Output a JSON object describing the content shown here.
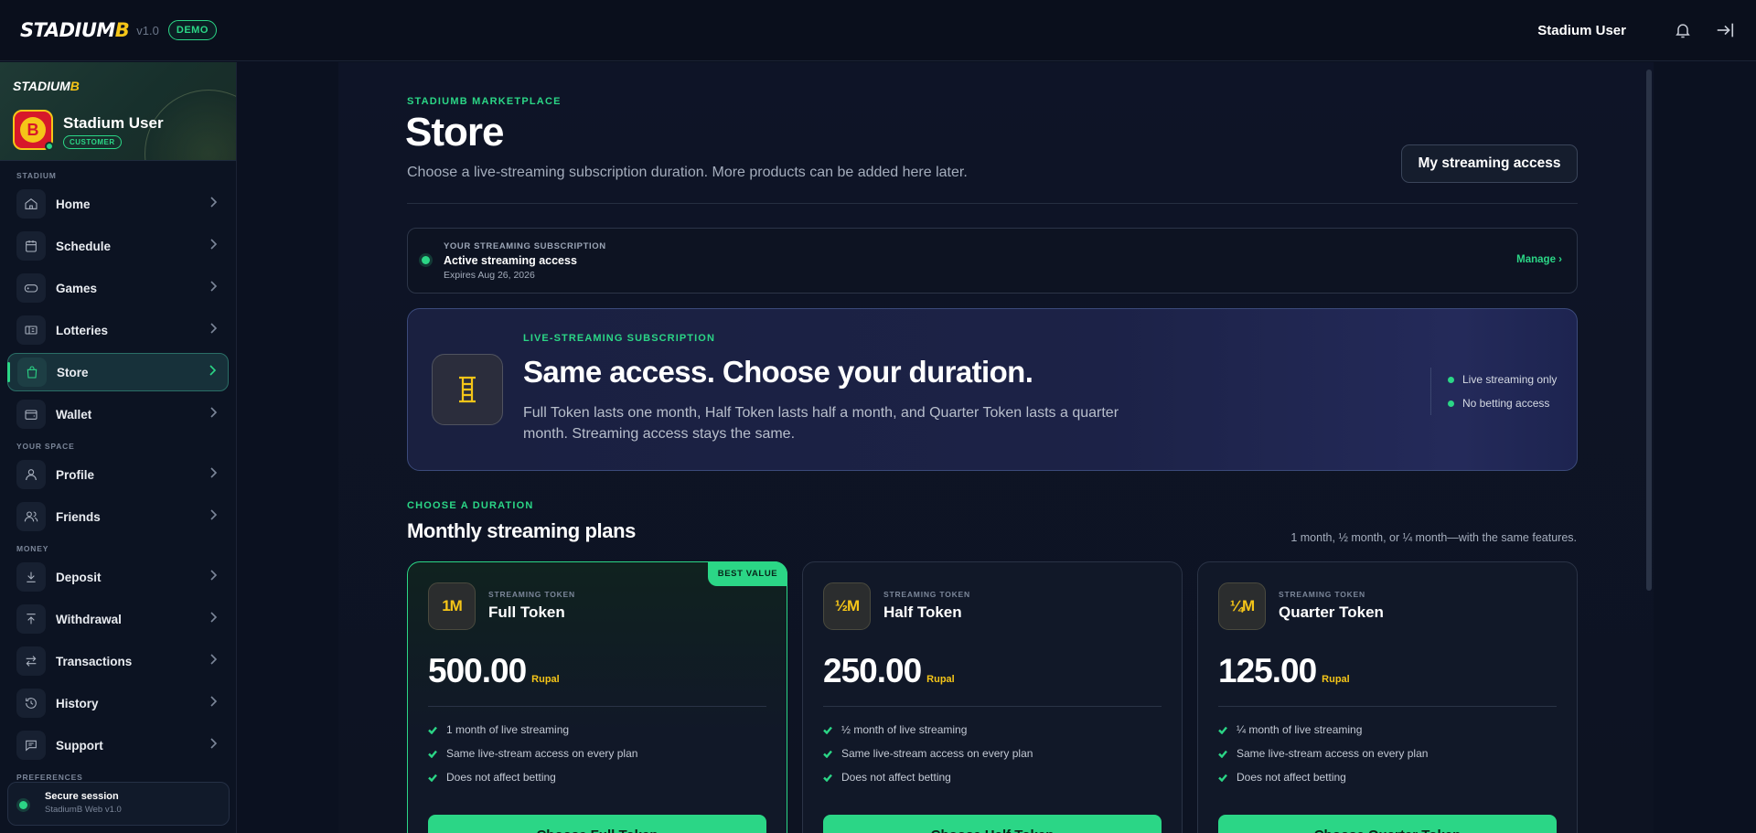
{
  "topbar": {
    "logo_main": "STADIUM",
    "logo_accent": "B",
    "version": "v1.0",
    "badge": "DEMO",
    "user": "Stadium User",
    "icons": [
      "bell-icon",
      "logout-icon"
    ]
  },
  "sidebar": {
    "mini_logo_main": "STADIUM",
    "mini_logo_accent": "B",
    "profile": {
      "avatar_letter": "B",
      "name": "Stadium User",
      "role": "CUSTOMER"
    },
    "sections": {
      "stadium": "STADIUM",
      "your_space": "YOUR SPACE",
      "money": "MONEY",
      "preferences": "PREFERENCES"
    },
    "items": {
      "home": "Home",
      "schedule": "Schedule",
      "games": "Games",
      "lotteries": "Lotteries",
      "store": "Store",
      "wallet": "Wallet",
      "profile": "Profile",
      "friends": "Friends",
      "deposit": "Deposit",
      "withdrawal": "Withdrawal",
      "transactions": "Transactions",
      "history": "History",
      "support": "Support"
    },
    "active": "Store",
    "secure": {
      "title": "Secure session",
      "subtitle": "StadiumB Web v1.0"
    }
  },
  "header": {
    "kicker": "STADIUMB MARKETPLACE",
    "title": "Store",
    "subtitle": "Choose a live-streaming subscription duration. More products can be added here later.",
    "access_button": "My streaming access"
  },
  "subscription": {
    "kicker": "YOUR STREAMING SUBSCRIPTION",
    "status": "Active streaming access",
    "expires": "Expires Aug 26, 2026",
    "manage": "Manage ›"
  },
  "hero": {
    "kicker": "LIVE-STREAMING SUBSCRIPTION",
    "title": "Same access. Choose your duration.",
    "description": "Full Token lasts one month, Half Token lasts half a month, and Quarter Token lasts a quarter month. Streaming access stays the same.",
    "features": [
      "Live streaming only",
      "No betting access"
    ]
  },
  "plans_section": {
    "kicker": "CHOOSE A DURATION",
    "title": "Monthly streaming plans",
    "note": "1 month, ½ month, or ¼ month—with the same features."
  },
  "plans": [
    {
      "badge": "BEST VALUE",
      "icon": "1M",
      "kicker": "STREAMING TOKEN",
      "name": "Full Token",
      "price": "500.00",
      "currency": "Rupal",
      "features": [
        "1 month of live streaming",
        "Same live-stream access on every plan",
        "Does not affect betting"
      ],
      "cta": "Choose Full Token"
    },
    {
      "icon": "½M",
      "kicker": "STREAMING TOKEN",
      "name": "Half Token",
      "price": "250.00",
      "currency": "Rupal",
      "features": [
        "½ month of live streaming",
        "Same live-stream access on every plan",
        "Does not affect betting"
      ],
      "cta": "Choose Half Token"
    },
    {
      "icon": "¼M",
      "kicker": "STREAMING TOKEN",
      "name": "Quarter Token",
      "price": "125.00",
      "currency": "Rupal",
      "features": [
        "¼ month of live streaming",
        "Same live-stream access on every plan",
        "Does not affect betting"
      ],
      "cta": "Choose Quarter Token"
    }
  ],
  "colors": {
    "accent_green": "#2bd686",
    "accent_gold": "#f5c518",
    "background": "#0b1120"
  }
}
